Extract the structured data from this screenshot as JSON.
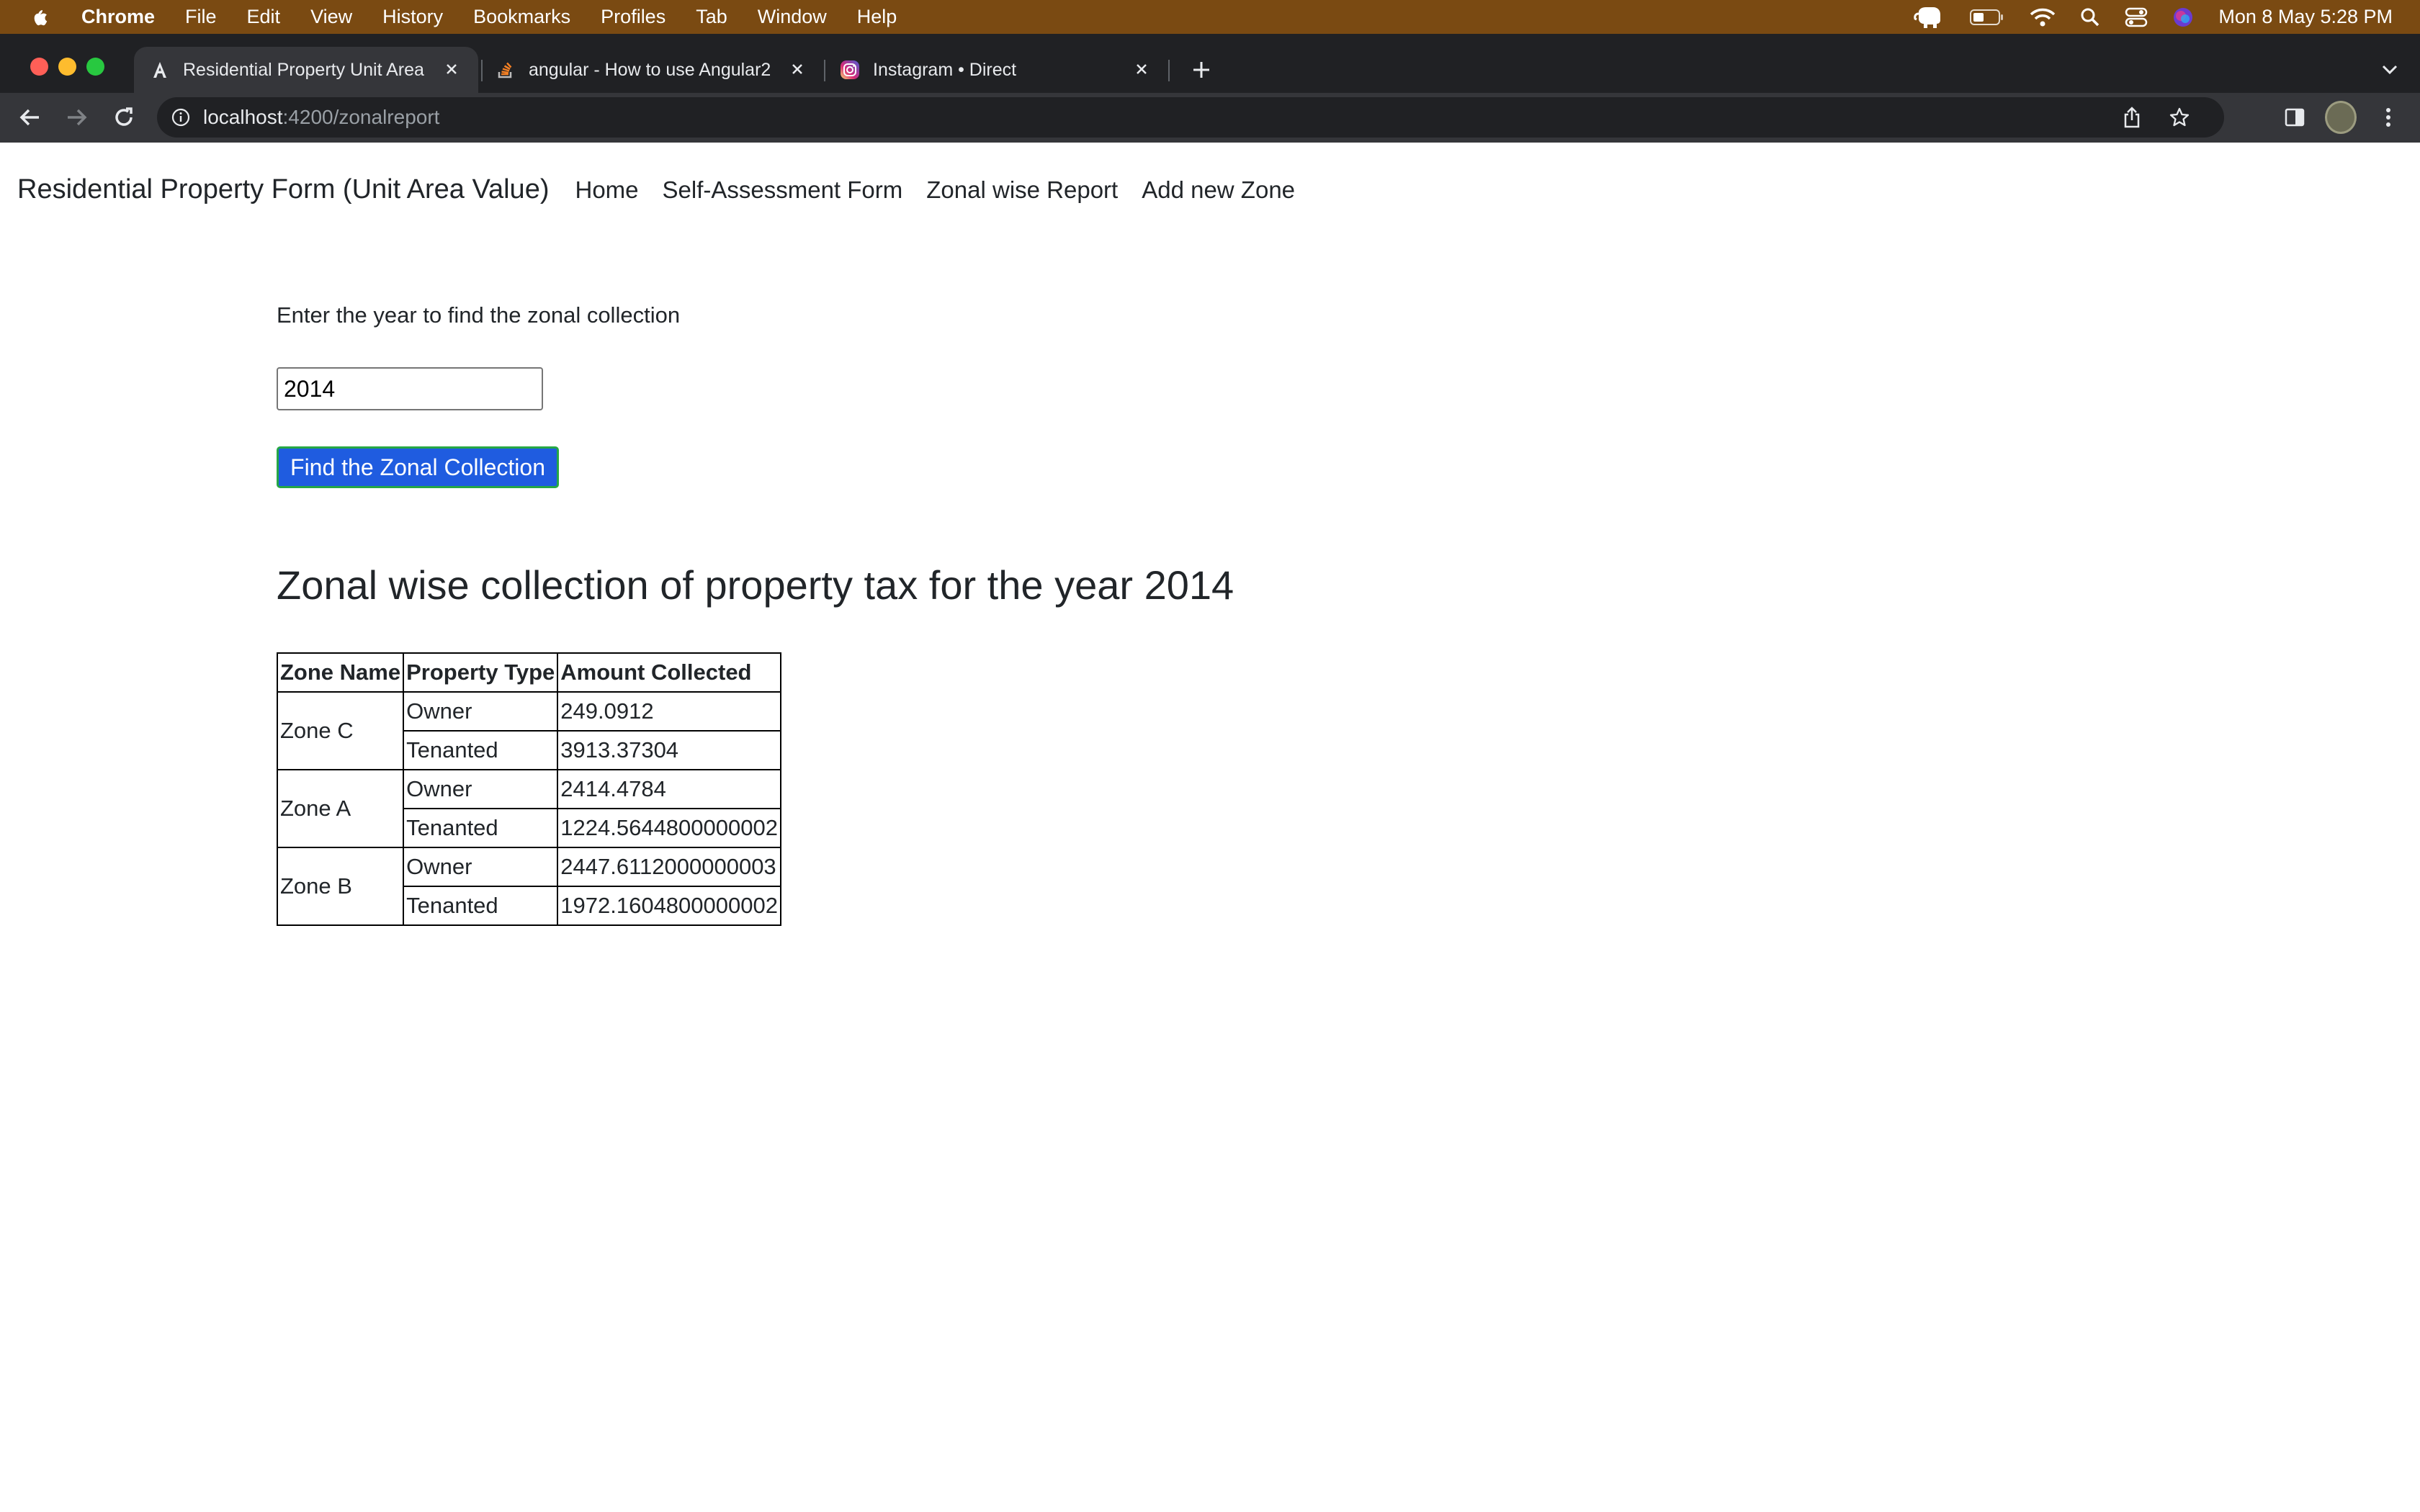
{
  "menubar": {
    "app_name": "Chrome",
    "items": [
      "File",
      "Edit",
      "View",
      "History",
      "Bookmarks",
      "Profiles",
      "Tab",
      "Window",
      "Help"
    ],
    "clock": "Mon 8 May  5:28 PM"
  },
  "browser": {
    "tabs": [
      {
        "title": "Residential Property Unit Area",
        "favicon": "angular-icon"
      },
      {
        "title": "angular - How to use Angular2",
        "favicon": "stackoverflow-icon"
      },
      {
        "title": "Instagram • Direct",
        "favicon": "instagram-icon"
      }
    ],
    "url_host": "localhost",
    "url_path": ":4200/zonalreport"
  },
  "navbar": {
    "brand": "Residential Property Form (Unit Area Value)",
    "links": [
      "Home",
      "Self-Assessment Form",
      "Zonal wise Report",
      "Add new Zone"
    ]
  },
  "form": {
    "prompt": "Enter the year to find the zonal collection",
    "year_value": "2014",
    "button_label": "Find the Zonal Collection"
  },
  "report": {
    "heading": "Zonal wise collection of property tax for the year 2014",
    "headers": [
      "Zone Name",
      "Property Type",
      "Amount Collected"
    ],
    "zones": [
      {
        "name": "Zone C",
        "rows": [
          {
            "type": "Owner",
            "amount": "249.0912"
          },
          {
            "type": "Tenanted",
            "amount": "3913.37304"
          }
        ]
      },
      {
        "name": "Zone A",
        "rows": [
          {
            "type": "Owner",
            "amount": "2414.4784"
          },
          {
            "type": "Tenanted",
            "amount": "1224.5644800000002"
          }
        ]
      },
      {
        "name": "Zone B",
        "rows": [
          {
            "type": "Owner",
            "amount": "2447.6112000000003"
          },
          {
            "type": "Tenanted",
            "amount": "1972.1604800000002"
          }
        ]
      }
    ]
  }
}
